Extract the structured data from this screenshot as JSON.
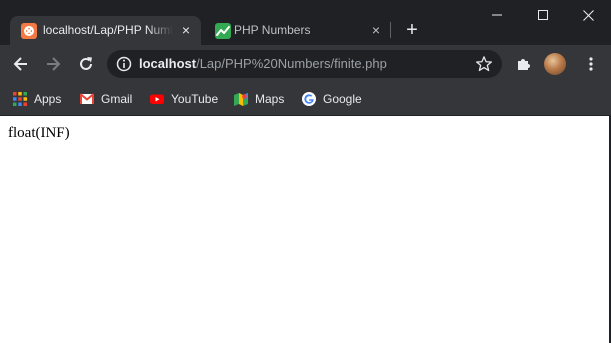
{
  "tabs": [
    {
      "title": "localhost/Lap/PHP Numbers/finite.php",
      "close": "×",
      "icon": "xampp-icon",
      "active": true
    },
    {
      "title": "PHP Numbers",
      "close": "×",
      "icon": "chart-icon",
      "active": false
    }
  ],
  "new_tab": "+",
  "address_bar": {
    "host": "localhost",
    "path": "/Lap/PHP%20Numbers/finite.php"
  },
  "bookmarks": [
    {
      "label": "Apps",
      "icon": "apps-grid-icon"
    },
    {
      "label": "Gmail",
      "icon": "gmail-icon"
    },
    {
      "label": "YouTube",
      "icon": "youtube-icon"
    },
    {
      "label": "Maps",
      "icon": "maps-icon"
    },
    {
      "label": "Google",
      "icon": "google-icon"
    }
  ],
  "page": {
    "output": "float(INF)"
  },
  "colors": {
    "titlebar": "#202124",
    "toolbar": "#35363a",
    "xampp_orange": "#f37b43",
    "chart_green": "#34a853"
  }
}
